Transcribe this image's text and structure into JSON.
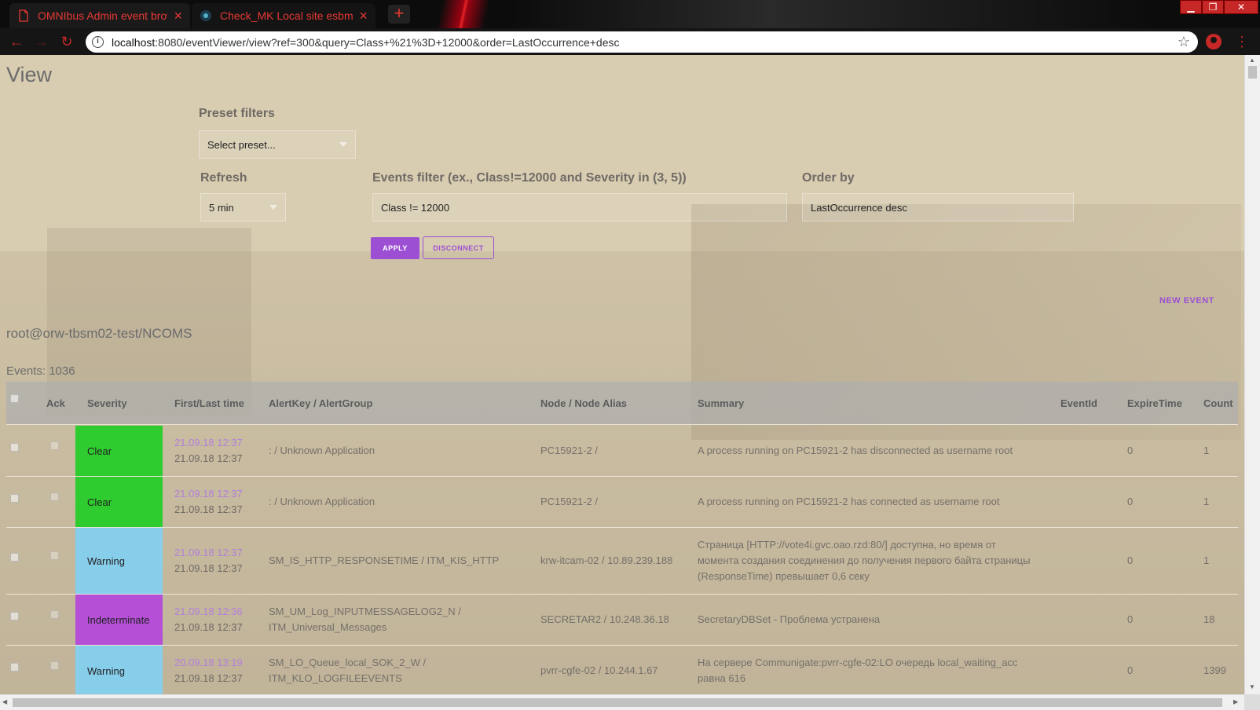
{
  "browser": {
    "tabs": [
      {
        "title": "OMNIbus Admin event browse"
      },
      {
        "title": "Check_MK Local site esbmon"
      }
    ],
    "new_tab": "+",
    "url_host": "localhost",
    "url_rest": ":8080/eventViewer/view?ref=300&query=Class+%21%3D+12000&order=LastOccurrence+desc"
  },
  "page": {
    "title": "View",
    "preset_label": "Preset filters",
    "preset_value": "Select preset...",
    "refresh_label": "Refresh",
    "refresh_value": "5 min",
    "filter_label": "Events filter (ex., Class!=12000 and Severity in (3, 5))",
    "filter_value": "Class != 12000",
    "order_label": "Order by",
    "order_value": "LastOccurrence desc",
    "apply_label": "APPLY",
    "disconnect_label": "DISCONNECT",
    "new_event_label": "NEW EVENT",
    "connection": "root@orw-tbsm02-test/NCOMS",
    "events_count": "Events: 1036"
  },
  "table": {
    "columns": {
      "ack": "Ack",
      "severity": "Severity",
      "time": "First/Last time",
      "alert": "AlertKey / AlertGroup",
      "node": "Node / Node Alias",
      "summary": "Summary",
      "eventid": "EventId",
      "expire": "ExpireTime",
      "count": "Count"
    },
    "rows": [
      {
        "severity": "Clear",
        "first": "21.09.18 12:37",
        "last": "21.09.18 12:37",
        "alert1": ": / Unknown Application",
        "alert2": "",
        "node": "PC15921-2 /",
        "sum1": "A process running on PC15921-2 has disconnected as username root",
        "sum2": "",
        "sum3": "",
        "eventid": "",
        "expire": "0",
        "count": "1"
      },
      {
        "severity": "Clear",
        "first": "21.09.18 12:37",
        "last": "21.09.18 12:37",
        "alert1": ": / Unknown Application",
        "alert2": "",
        "node": "PC15921-2 /",
        "sum1": "A process running on PC15921-2 has connected as username root",
        "sum2": "",
        "sum3": "",
        "eventid": "",
        "expire": "0",
        "count": "1"
      },
      {
        "severity": "Warning",
        "first": "21.09.18 12:37",
        "last": "21.09.18 12:37",
        "alert1": "SM_IS_HTTP_RESPONSETIME / ITM_KIS_HTTP",
        "alert2": "",
        "node": "krw-itcam-02 / 10.89.239.188",
        "sum1": "Страница [HTTP://vote4i.gvc.oao.rzd:80/] доступна, но время от",
        "sum2": "момента создания соединения до получения первого байта страницы",
        "sum3": "(ResponseTime) превышает 0,6 секу",
        "eventid": "",
        "expire": "0",
        "count": "1"
      },
      {
        "severity": "Indeterminate",
        "first": "21.09.18 12:36",
        "last": "21.09.18 12:37",
        "alert1": "SM_UM_Log_INPUTMESSAGELOG2_N /",
        "alert2": "ITM_Universal_Messages",
        "node": "SECRETAR2 / 10.248.36.18",
        "sum1": "SecretaryDBSet - Проблема устранена",
        "sum2": "",
        "sum3": "",
        "eventid": "",
        "expire": "0",
        "count": "18"
      },
      {
        "severity": "Warning",
        "first": "20.09.18 13:19",
        "last": "21.09.18 12:37",
        "alert1": "SM_LO_Queue_local_SOK_2_W /",
        "alert2": "ITM_KLO_LOGFILEEVENTS",
        "node": "pvrr-cgfe-02 / 10.244.1.67",
        "sum1": "На сервере Communigate:pvrr-cgfe-02:LO очередь local_waiting_acc",
        "sum2": "равна 616",
        "sum3": "",
        "eventid": "",
        "expire": "0",
        "count": "1399"
      }
    ]
  },
  "colors": {
    "accent": "#9c4fd3",
    "sev_clear": "#2ecc2e",
    "sev_warning": "#87ceeb",
    "sev_indeterminate": "#b44fd6",
    "browser_red": "#e53935"
  }
}
